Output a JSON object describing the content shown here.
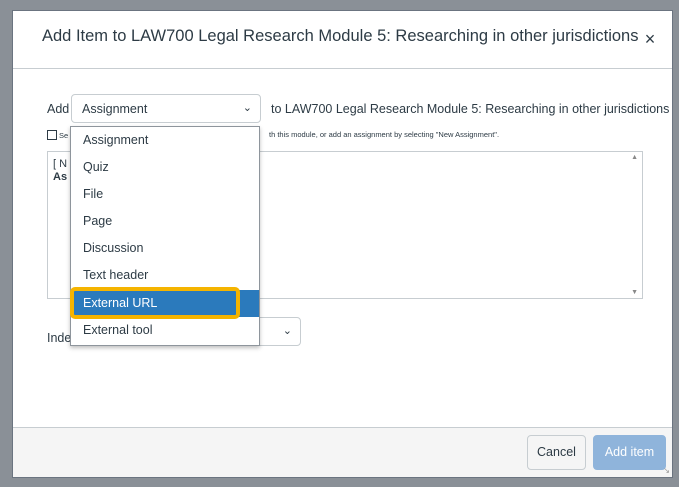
{
  "modal": {
    "title": "Add Item to LAW700 Legal Research Module 5: Researching in other jurisdictions",
    "close_icon": "close-icon",
    "close_glyph": "×"
  },
  "add_row": {
    "label": "Add",
    "selected_type": "Assignment",
    "to_text": "to LAW700 Legal Research Module 5: Researching in other jurisdictions"
  },
  "hint": {
    "prefix": "Se",
    "text": "th this module, or add an assignment by selecting \"New Assignment\"."
  },
  "listbox": {
    "line1": "[ N",
    "line2": "As"
  },
  "indent": {
    "label": "Inde"
  },
  "dropdown": {
    "options": [
      "Assignment",
      "Quiz",
      "File",
      "Page",
      "Discussion",
      "Text header",
      "External URL",
      "External tool"
    ],
    "selected_index": 6
  },
  "footer": {
    "cancel_label": "Cancel",
    "add_label": "Add item"
  },
  "colors": {
    "selected_option": "#2b7abc",
    "highlight_outline": "#f5b400",
    "add_button": "#8fb4db"
  }
}
